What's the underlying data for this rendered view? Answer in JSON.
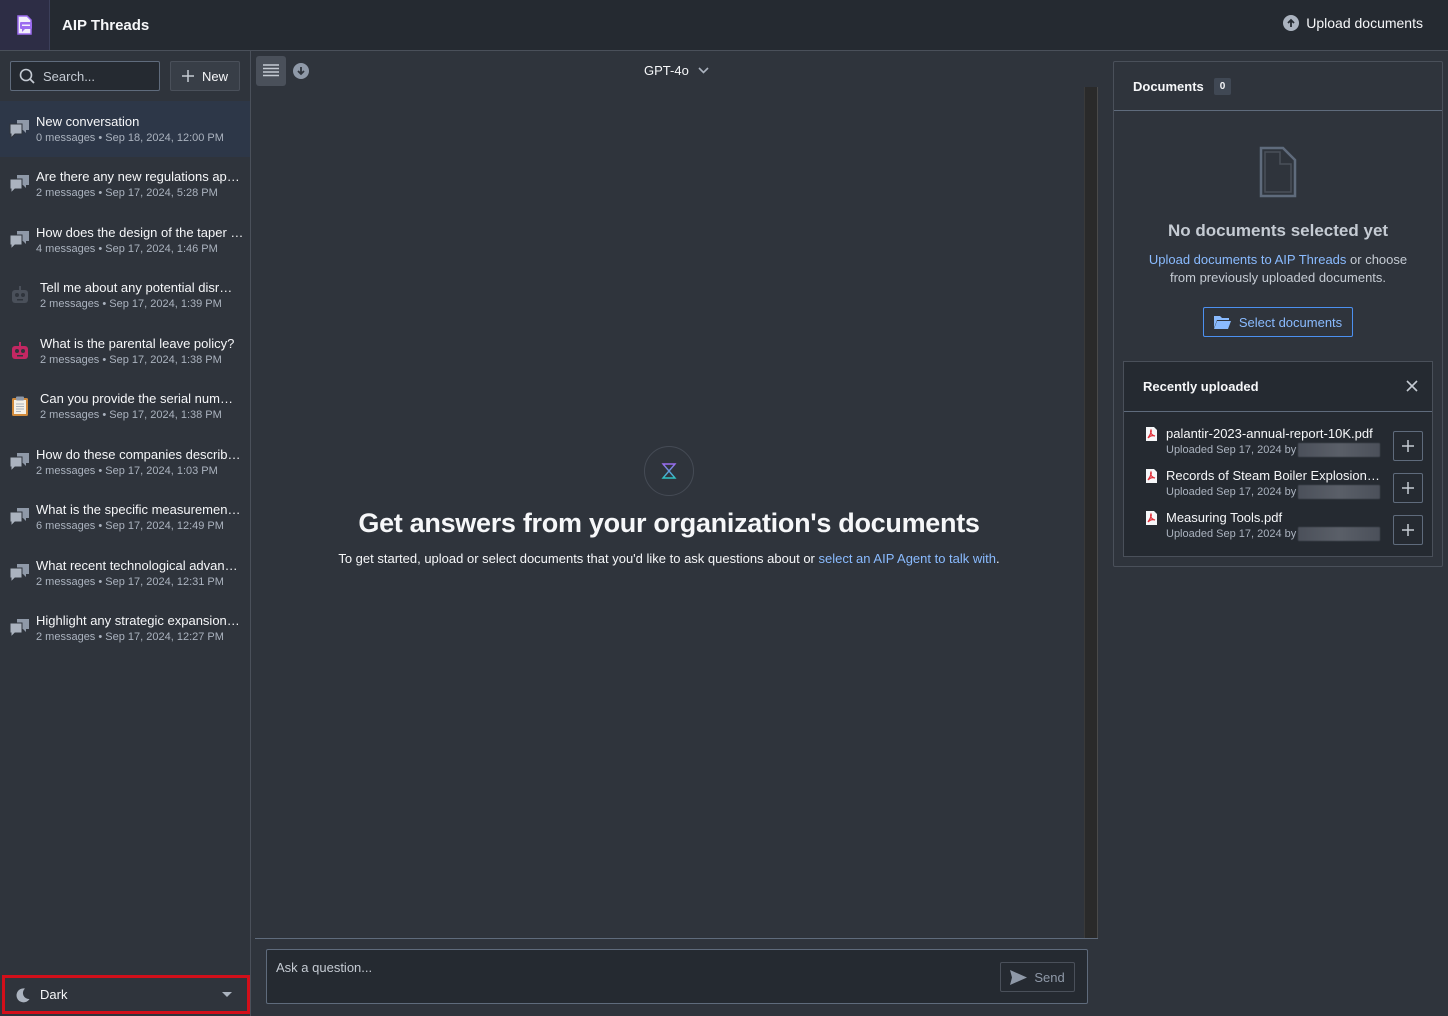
{
  "app": {
    "title": "AIP Threads",
    "upload_label": "Upload documents"
  },
  "sidebar": {
    "search_placeholder": "Search...",
    "new_label": "New",
    "conversations": [
      {
        "title": "New conversation",
        "meta": "0 messages • Sep 18, 2024, 12:00 PM",
        "icon": "chat-icon",
        "active": true
      },
      {
        "title": "Are there any new regulations ap…",
        "meta": "2 messages • Sep 17, 2024, 5:28 PM",
        "icon": "chat-icon"
      },
      {
        "title": "How does the design of the taper …",
        "meta": "4 messages • Sep 17, 2024, 1:46 PM",
        "icon": "chat-icon"
      },
      {
        "title": "Tell me about any potential disr…",
        "meta": "2 messages • Sep 17, 2024, 1:39 PM",
        "icon": "robot-icon-gray"
      },
      {
        "title": "What is the parental leave policy?",
        "meta": "2 messages • Sep 17, 2024, 1:38 PM",
        "icon": "robot-icon-pink"
      },
      {
        "title": "Can you provide the serial numb…",
        "meta": "2 messages • Sep 17, 2024, 1:38 PM",
        "icon": "clipboard-icon"
      },
      {
        "title": "How do these companies describ…",
        "meta": "2 messages • Sep 17, 2024, 1:03 PM",
        "icon": "chat-icon"
      },
      {
        "title": "What is the specific measuremen…",
        "meta": "6 messages • Sep 17, 2024, 12:49 PM",
        "icon": "chat-icon"
      },
      {
        "title": "What recent technological advan…",
        "meta": "2 messages • Sep 17, 2024, 12:31 PM",
        "icon": "chat-icon"
      },
      {
        "title": "Highlight any strategic expansion…",
        "meta": "2 messages • Sep 17, 2024, 12:27 PM",
        "icon": "chat-icon"
      }
    ],
    "theme": {
      "label": "Dark",
      "icon": "moon-icon"
    }
  },
  "main": {
    "model": "GPT-4o",
    "empty_title": "Get answers from your organization's documents",
    "empty_sub_text": "To get started, upload or select documents that you'd like to ask questions about or ",
    "empty_sub_link": "select an AIP Agent to talk with",
    "empty_sub_end": ".",
    "ask_placeholder": "Ask a question...",
    "send_label": "Send"
  },
  "documents": {
    "title": "Documents",
    "count": "0",
    "empty_title": "No documents selected yet",
    "empty_link": "Upload documents to AIP Threads",
    "empty_text": " or choose from previously uploaded documents.",
    "select_label": "Select documents",
    "recent": {
      "title": "Recently uploaded",
      "files": [
        {
          "name": "palantir-2023-annual-report-10K.pdf",
          "uploaded": "Uploaded Sep 17, 2024 by"
        },
        {
          "name": "Records of Steam Boiler Explosions.pdf",
          "uploaded": "Uploaded Sep 17, 2024 by"
        },
        {
          "name": "Measuring Tools.pdf",
          "uploaded": "Uploaded Sep 17, 2024 by"
        }
      ]
    }
  },
  "colors": {
    "accent_link": "#8abbff",
    "highlight_border": "#d20f1a",
    "logo": "#9b6bf0"
  }
}
